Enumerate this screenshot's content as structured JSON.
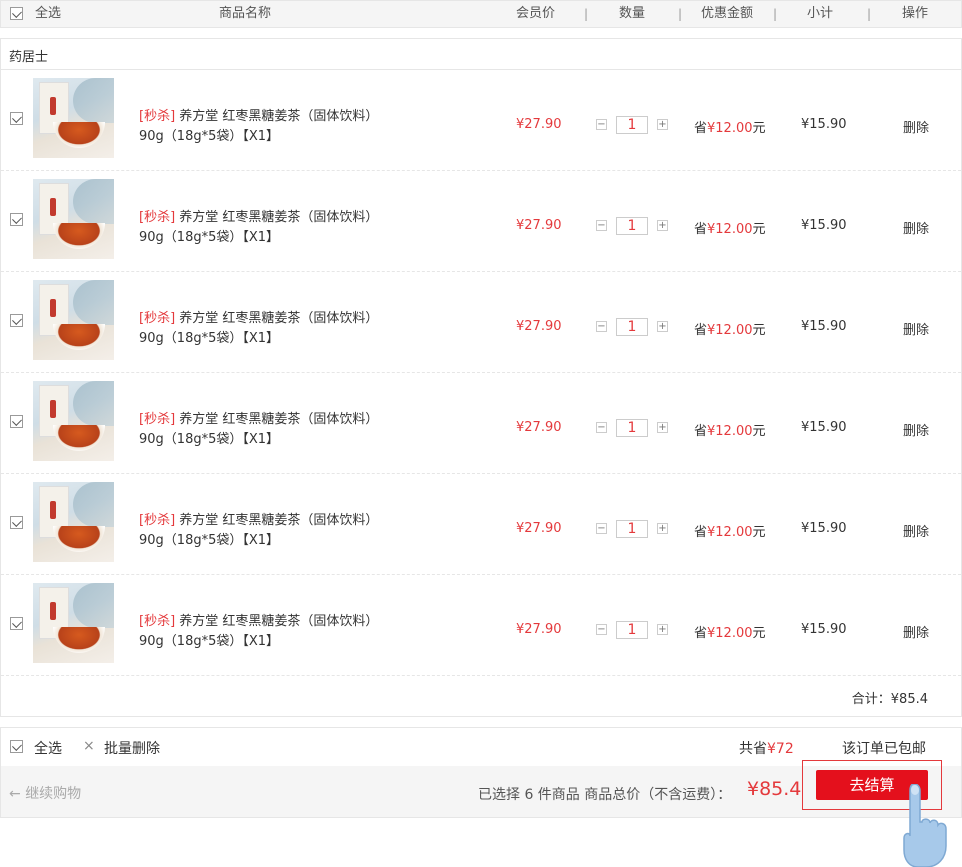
{
  "header": {
    "select_all": "全选",
    "product_name": "商品名称",
    "member_price": "会员价",
    "quantity": "数量",
    "discount": "优惠金额",
    "subtotal": "小计",
    "actions": "操作",
    "separator": "|"
  },
  "store": {
    "name": "药居士",
    "items": [
      {
        "tag": "[秒杀]",
        "name_line1": "养方堂  红枣黑糖姜茶（固体饮料）",
        "name_line2": "90g（18g*5袋）【X1】",
        "price": "¥27.90",
        "qty": "1",
        "save_prefix": "省",
        "save_amount": "¥12.00",
        "save_suffix": "元",
        "subtotal": "¥15.90",
        "delete": "删除"
      },
      {
        "tag": "[秒杀]",
        "name_line1": "养方堂  红枣黑糖姜茶（固体饮料）",
        "name_line2": "90g（18g*5袋）【X1】",
        "price": "¥27.90",
        "qty": "1",
        "save_prefix": "省",
        "save_amount": "¥12.00",
        "save_suffix": "元",
        "subtotal": "¥15.90",
        "delete": "删除"
      },
      {
        "tag": "[秒杀]",
        "name_line1": "养方堂  红枣黑糖姜茶（固体饮料）",
        "name_line2": "90g（18g*5袋）【X1】",
        "price": "¥27.90",
        "qty": "1",
        "save_prefix": "省",
        "save_amount": "¥12.00",
        "save_suffix": "元",
        "subtotal": "¥15.90",
        "delete": "删除"
      },
      {
        "tag": "[秒杀]",
        "name_line1": "养方堂  红枣黑糖姜茶（固体饮料）",
        "name_line2": "90g（18g*5袋）【X1】",
        "price": "¥27.90",
        "qty": "1",
        "save_prefix": "省",
        "save_amount": "¥12.00",
        "save_suffix": "元",
        "subtotal": "¥15.90",
        "delete": "删除"
      },
      {
        "tag": "[秒杀]",
        "name_line1": "养方堂  红枣黑糖姜茶（固体饮料）",
        "name_line2": "90g（18g*5袋）【X1】",
        "price": "¥27.90",
        "qty": "1",
        "save_prefix": "省",
        "save_amount": "¥12.00",
        "save_suffix": "元",
        "subtotal": "¥15.90",
        "delete": "删除"
      },
      {
        "tag": "[秒杀]",
        "name_line1": "养方堂  红枣黑糖姜茶（固体饮料）",
        "name_line2": "90g（18g*5袋）【X1】",
        "price": "¥27.90",
        "qty": "1",
        "save_prefix": "省",
        "save_amount": "¥12.00",
        "save_suffix": "元",
        "subtotal": "¥15.90",
        "delete": "删除"
      }
    ],
    "total": "合计：¥85.4"
  },
  "footer": {
    "select_all": "全选",
    "batch_delete_icon": "×",
    "batch_delete": "批量删除",
    "saved_prefix": "共省",
    "saved_amount": "¥72",
    "shipping": "该订单已包邮",
    "continue_arrow": "←",
    "continue_shopping": "继续购物",
    "summary": "已选择 6 件商品 商品总价（不含运费）：",
    "grand_total": "¥85.4",
    "checkout": "去结算"
  },
  "icons": {
    "checkbox": "checkbox-icon",
    "minus": "minus-icon",
    "plus": "plus-icon",
    "pointer_hand": "pointer-hand-icon"
  },
  "colors": {
    "accent": "#e4393c",
    "checkout_bg": "#e4101c",
    "header_bg": "#f5f5f5",
    "border": "#e6e6e6"
  }
}
